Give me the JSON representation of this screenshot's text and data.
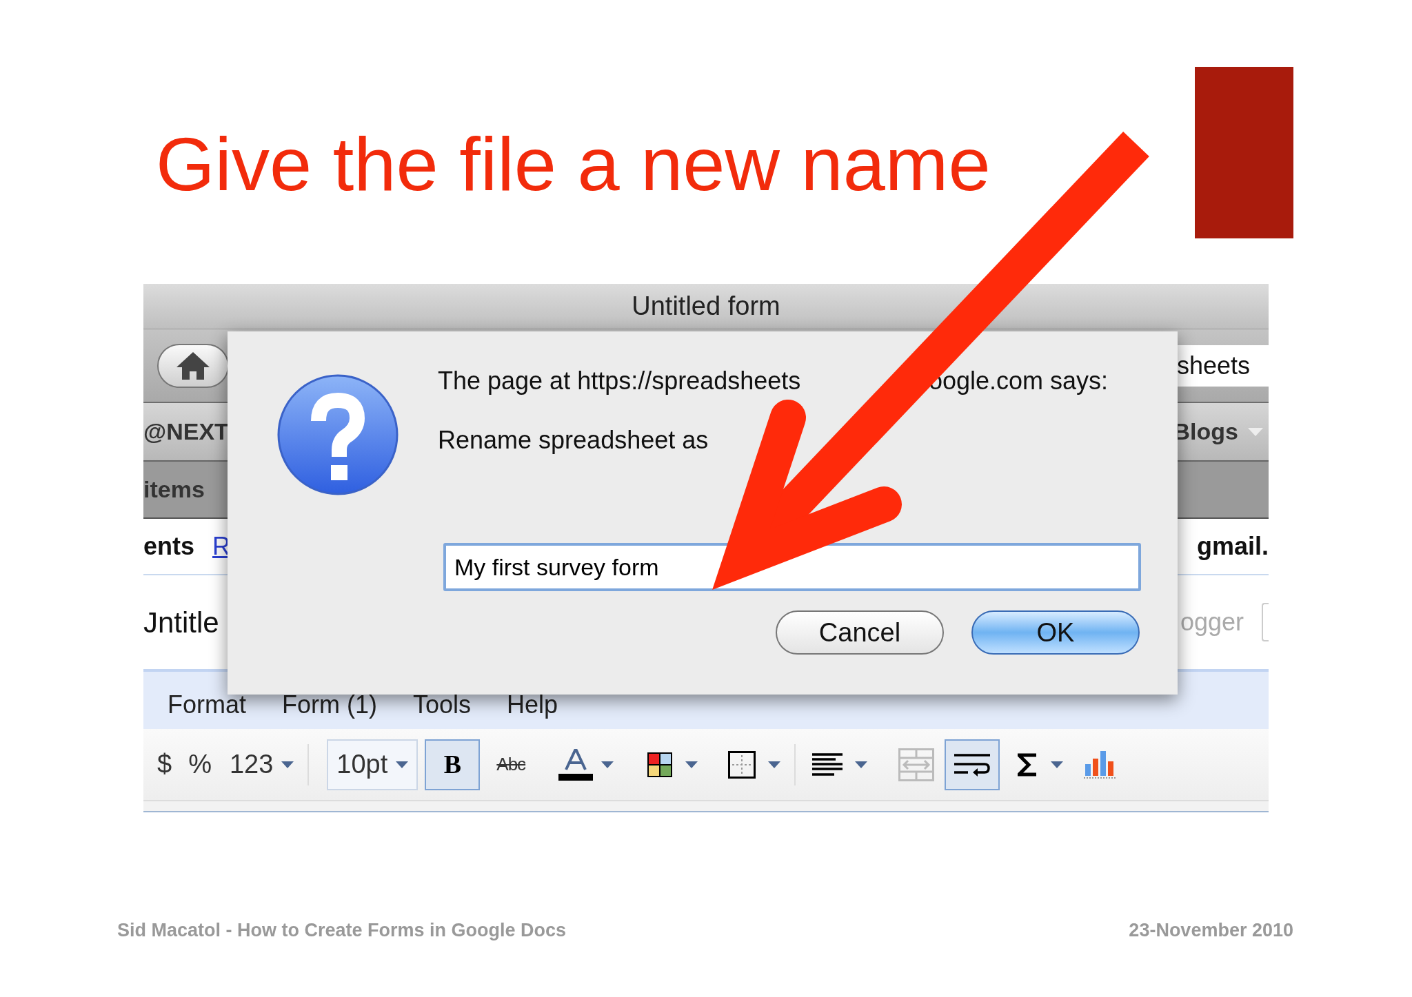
{
  "slide": {
    "title": "Give the file a new name",
    "footer_left": "Sid Macatol - How to Create Forms in Google Docs",
    "footer_right": "23-November 2010"
  },
  "browser": {
    "title": "Untitled form",
    "address_fragment": "sheets",
    "bookmark_left": "@NEXT",
    "bookmark_right": "Blogs",
    "tab_left": "items",
    "links": [
      "ents",
      "R"
    ],
    "account": "gmail.",
    "doc_title": "Jntitle",
    "share_fragment": "ogger"
  },
  "menu": [
    "Format",
    "Form (1)",
    "Tools",
    "Help"
  ],
  "toolbar": [
    {
      "kind": "symbol",
      "label": "$"
    },
    {
      "kind": "symbol",
      "label": "%"
    },
    {
      "kind": "dropdown",
      "label": "123"
    },
    {
      "kind": "separator"
    },
    {
      "kind": "select",
      "label": "10pt"
    },
    {
      "kind": "bold",
      "label": "B",
      "on": true
    },
    {
      "kind": "strike",
      "label": "Abc",
      "on": false
    },
    {
      "kind": "text-color"
    },
    {
      "kind": "fill-color"
    },
    {
      "kind": "borders"
    },
    {
      "kind": "separator"
    },
    {
      "kind": "align"
    },
    {
      "kind": "merge",
      "disabled": true
    },
    {
      "kind": "wrap",
      "on": true
    },
    {
      "kind": "sum"
    },
    {
      "kind": "chart"
    }
  ],
  "dialog": {
    "message_parts": [
      "The page at https://spreadsheets",
      "oogle.com says:"
    ],
    "prompt": "Rename spreadsheet as",
    "input_value": "My first survey form",
    "buttons": [
      {
        "label": "Cancel",
        "default": false
      },
      {
        "label": "OK",
        "default": true
      }
    ]
  }
}
